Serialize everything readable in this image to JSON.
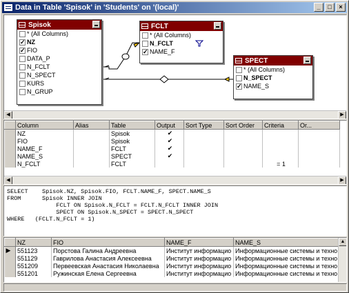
{
  "window": {
    "title": "Data in Table 'Spisok' in 'Students' on '(local)'",
    "minimize": "_",
    "maximize": "□",
    "close": "×"
  },
  "diagram": {
    "tables": [
      {
        "name": "Spisok",
        "rows": [
          {
            "label": "* (All Columns)",
            "checked": false,
            "bold": false
          },
          {
            "label": "NZ",
            "checked": true,
            "bold": true
          },
          {
            "label": "FIO",
            "checked": true,
            "bold": false
          },
          {
            "label": "DATA_P",
            "checked": false,
            "bold": false
          },
          {
            "label": "N_FCLT",
            "checked": false,
            "bold": false
          },
          {
            "label": "N_SPECT",
            "checked": false,
            "bold": false
          },
          {
            "label": "KURS",
            "checked": false,
            "bold": false
          },
          {
            "label": "N_GRUP",
            "checked": false,
            "bold": false
          }
        ]
      },
      {
        "name": "FCLT",
        "rows": [
          {
            "label": "* (All Columns)",
            "checked": false,
            "bold": false
          },
          {
            "label": "N_FCLT",
            "checked": false,
            "bold": true
          },
          {
            "label": "NAME_F",
            "checked": true,
            "bold": false
          }
        ]
      },
      {
        "name": "SPECT",
        "rows": [
          {
            "label": "* (All Columns)",
            "checked": false,
            "bold": false
          },
          {
            "label": "N_SPECT",
            "checked": false,
            "bold": true
          },
          {
            "label": "NAME_S",
            "checked": true,
            "bold": false
          }
        ]
      }
    ],
    "filter_icon": "funnel-icon"
  },
  "grid": {
    "headers": [
      "Column",
      "Alias",
      "Table",
      "Output",
      "Sort Type",
      "Sort Order",
      "Criteria",
      "Or..."
    ],
    "rows": [
      [
        "NZ",
        "",
        "Spisok",
        "✔",
        "",
        "",
        "",
        ""
      ],
      [
        "FIO",
        "",
        "Spisok",
        "✔",
        "",
        "",
        "",
        ""
      ],
      [
        "NAME_F",
        "",
        "FCLT",
        "✔",
        "",
        "",
        "",
        ""
      ],
      [
        "NAME_S",
        "",
        "SPECT",
        "✔",
        "",
        "",
        "",
        ""
      ],
      [
        "N_FCLT",
        "",
        "FCLT",
        "",
        "",
        "",
        "= 1",
        ""
      ]
    ]
  },
  "sql": {
    "text": "SELECT    Spisok.NZ, Spisok.FIO, FCLT.NAME_F, SPECT.NAME_S\nFROM      Spisok INNER JOIN\n              FCLT ON Spisok.N_FCLT = FCLT.N_FCLT INNER JOIN\n              SPECT ON Spisok.N_SPECT = SPECT.N_SPECT\nWHERE   (FCLT.N_FCLT = 1)"
  },
  "results": {
    "headers": [
      "NZ",
      "FIO",
      "NAME_F",
      "NAME_S"
    ],
    "rows": [
      [
        "551123",
        "Порстова Галина Андреевна",
        "Институт информацио",
        "Информационные системы и техно"
      ],
      [
        "551129",
        "Гаврилова Анастасия Алексеевна",
        "Институт информацио",
        "Информационные системы и техно"
      ],
      [
        "551209",
        "Первеевская Анастасия Николаевна",
        "Институт информацио",
        "Информационные системы и техно"
      ],
      [
        "551201",
        "Ружинская Елена Сергеевна",
        "Институт информацио",
        "Информационные системы и техно"
      ]
    ],
    "current_row_marker": "▶"
  },
  "colors": {
    "table_header": "#800000",
    "title_start": "#0a246a",
    "title_end": "#a6caf0"
  }
}
